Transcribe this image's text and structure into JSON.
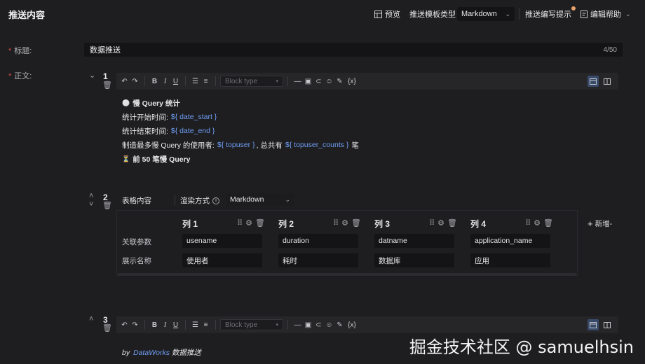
{
  "header": {
    "title": "推送内容",
    "preview_label": "预览",
    "template_type_label": "推送模板类型",
    "template_type_value": "Markdown",
    "writing_tips_label": "推送编写提示",
    "edit_help_label": "编辑帮助"
  },
  "form": {
    "title_label": "标题:",
    "title_value": "数据推送",
    "title_counter": "4/50",
    "body_label": "正文:"
  },
  "blocks": [
    {
      "number": "1",
      "block_type_placeholder": "Block type",
      "lines": {
        "heading_icon": "⚪",
        "heading": "慢 Query 统计",
        "start_label": "统计开始时间:",
        "start_var": "${ date_start }",
        "end_label": "统计结束时间:",
        "end_var": "${ date_end }",
        "user_prefix": "制造最多慢 Query 的使用者:",
        "user_var": "${ topuser }",
        "user_mid": ", 总共有",
        "count_var": "${ topuser_counts }",
        "user_suffix": "笔",
        "top_icon": "⏳",
        "top_text": "前 50 笔慢 Query"
      }
    },
    {
      "number": "2",
      "table_label": "表格内容",
      "render_label": "渲染方式",
      "render_value": "Markdown",
      "add_label": "新增-",
      "columns": [
        "列 1",
        "列 2",
        "列 3",
        "列 4"
      ],
      "row_labels": [
        "关联参数",
        "展示名称"
      ],
      "params": [
        "usename",
        "duration",
        "datname",
        "application_name"
      ],
      "names": [
        "使用者",
        "耗时",
        "数据库",
        "应用"
      ]
    },
    {
      "number": "3",
      "block_type_placeholder": "Block type",
      "footer_by": "by",
      "footer_brand": "DataWorks",
      "footer_text": "数据推送"
    }
  ],
  "watermark": "掘金技术社区 @ samuelhsin",
  "colors": {
    "accent_blue": "#6e9cf2",
    "required_red": "#d94b4b",
    "badge_orange": "#e8a36d"
  }
}
